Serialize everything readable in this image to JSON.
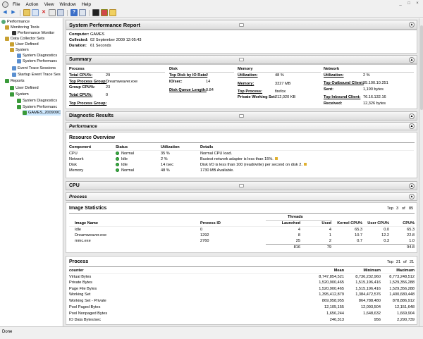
{
  "menu": [
    "File",
    "Action",
    "View",
    "Window",
    "Help"
  ],
  "window_controls": [
    "_",
    "□",
    "×"
  ],
  "status": "Done",
  "tree": [
    {
      "label": "Performance",
      "indent": 0,
      "color": "#5a7"
    },
    {
      "label": "Monitoring Tools",
      "indent": 1,
      "color": "#c8a030"
    },
    {
      "label": "Performance Monitor",
      "indent": 2,
      "color": "#333"
    },
    {
      "label": "Data Collector Sets",
      "indent": 1,
      "color": "#c8a030"
    },
    {
      "label": "User Defined",
      "indent": 2,
      "color": "#c8a030"
    },
    {
      "label": "System",
      "indent": 2,
      "color": "#c8a030"
    },
    {
      "label": "System Diagnostics",
      "indent": 3,
      "color": "#5a8fd0"
    },
    {
      "label": "System Performanc",
      "indent": 3,
      "color": "#5a8fd0"
    },
    {
      "label": "Event Trace Sessions",
      "indent": 2,
      "color": "#5a8fd0"
    },
    {
      "label": "Startup Event Trace Ses",
      "indent": 2,
      "color": "#5a8fd0"
    },
    {
      "label": "Reports",
      "indent": 1,
      "color": "#3a9a3a"
    },
    {
      "label": "User Defined",
      "indent": 2,
      "color": "#3a9a3a"
    },
    {
      "label": "System",
      "indent": 2,
      "color": "#3a9a3a"
    },
    {
      "label": "System Diagnostics",
      "indent": 3,
      "color": "#3a9a3a"
    },
    {
      "label": "System Performanc",
      "indent": 3,
      "color": "#3a9a3a"
    },
    {
      "label": "GAMES_200909C",
      "indent": 4,
      "color": "#3a9a3a",
      "selected": true
    }
  ],
  "report": {
    "title": "System Performance Report",
    "computer_label": "Computer:",
    "computer": "GAMES",
    "collected_label": "Collected:",
    "collected": "02 September 2009 12:05:43",
    "duration_label": "Duration:",
    "duration": "61 Seconds"
  },
  "summary": {
    "title": "Summary",
    "process": {
      "head": "Process",
      "rows": [
        [
          "Total CPU%:",
          "29"
        ],
        [
          "Top Process Group:",
          "Dreamweaver.exe"
        ],
        [
          "Group CPU%:",
          "23"
        ],
        [
          "Total CPU%:",
          "0"
        ],
        [
          "Top Process Group:",
          ""
        ]
      ]
    },
    "disk": {
      "head": "Disk",
      "rows": [
        [
          "Top Disk by IO Rate:",
          "2"
        ],
        [
          "IO/sec:",
          "14"
        ],
        [
          "Disk Queue Length:",
          "0.84"
        ]
      ]
    },
    "memory": {
      "head": "Memory",
      "rows": [
        [
          "Utilization:",
          "48 %"
        ],
        [
          "Memory:",
          "3327 MB"
        ],
        [
          "Top Process:",
          "firefox"
        ],
        [
          "Private Working Set:",
          "212,020 KB"
        ]
      ]
    },
    "network": {
      "head": "Network",
      "rows": [
        [
          "Utilization:",
          "2 %"
        ],
        [
          "Top Outbound Client:",
          "95.100.10.251"
        ],
        [
          "Sent:",
          "1,190 bytes"
        ],
        [
          "Top Inbound Client:",
          "76.16.132.16"
        ],
        [
          "Received:",
          "12,326 bytes"
        ]
      ]
    }
  },
  "diagnostic": {
    "title": "Diagnostic Results",
    "performance": "Performance"
  },
  "resource": {
    "title": "Resource Overview",
    "headers": [
      "Component",
      "Status",
      "Utilization",
      "Details"
    ],
    "rows": [
      [
        "CPU",
        "Normal",
        "35 %",
        "Normal CPU load."
      ],
      [
        "Network",
        "Idle",
        "2 %",
        "Busiest network adapter is less than 15%."
      ],
      [
        "Disk",
        "Idle",
        "14 /sec",
        "Disk I/O is less than 100 (read/write) per second on disk 2."
      ],
      [
        "Memory",
        "Normal",
        "48 %",
        "1730 MB Available."
      ]
    ]
  },
  "cpu": {
    "title": "CPU",
    "process": "Process"
  },
  "image_stats": {
    "title": "Image Statistics",
    "top": "Top",
    "top_n": "3",
    "of": "of",
    "total": "85",
    "threads": "Threads",
    "headers": [
      "Image Name",
      "Process ID",
      "Launched",
      "Used",
      "Kernel CPU%",
      "User CPU%",
      "CPU%"
    ],
    "rows": [
      [
        "Idle",
        "0",
        "4",
        "4",
        "65.3",
        "0.0",
        "65.3"
      ],
      [
        "Dreamweaver.exe",
        "1292",
        "8",
        "1",
        "10.7",
        "12.2",
        "22.8"
      ],
      [
        "mmc.exe",
        "2760",
        "25",
        "2",
        "0.7",
        "0.3",
        "1.0"
      ]
    ],
    "totals": [
      "816",
      "79",
      "94.8"
    ]
  },
  "process": {
    "title": "Process",
    "top": "Top",
    "top_n": "21",
    "of": "of",
    "total": "21",
    "headers": [
      "counter",
      "Mean",
      "Minimum",
      "Maximum"
    ],
    "rows": [
      [
        "Virtual Bytes",
        "8,747,854,521",
        "8,736,232,960",
        "8,773,248,512"
      ],
      [
        "Private Bytes",
        "1,520,900,465",
        "1,515,196,416",
        "1,529,356,288"
      ],
      [
        "Page File Bytes",
        "1,520,900,465",
        "1,515,196,416",
        "1,529,356,288"
      ],
      [
        "Working Set",
        "1,395,412,879",
        "1,384,472,576",
        "1,400,680,448"
      ],
      [
        "Working Set - Private",
        "869,958,955",
        "864,788,480",
        "878,886,912"
      ],
      [
        "Pool Paged Bytes",
        "12,105,155",
        "12,093,504",
        "12,151,648"
      ],
      [
        "Pool Nonpaged Bytes",
        "1,656,244",
        "1,648,632",
        "1,669,904"
      ],
      [
        "IO Data Bytes/sec",
        "246,313",
        "956",
        "2,290,739"
      ]
    ]
  }
}
